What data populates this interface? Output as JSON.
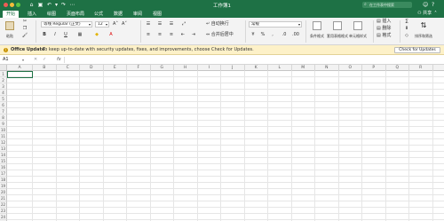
{
  "window": {
    "title": "工作簿1",
    "search_placeholder": "在工作表中搜索"
  },
  "tabs": [
    "开始",
    "插入",
    "绘图",
    "页面布局",
    "公式",
    "数据",
    "审阅",
    "视图"
  ],
  "share_label": "共享",
  "ribbon": {
    "paste_label": "粘贴",
    "font_name": "等线 Regular (正文)",
    "font_size": "12",
    "wrap_label": "自动换行",
    "merge_label": "合并后居中",
    "number_format": "常规",
    "cond_format_label": "条件格式",
    "table_format_label": "套用表格格式",
    "cell_style_label": "单元格样式",
    "insert_label": "插入",
    "delete_label": "删除",
    "format_label": "格式",
    "sort_filter_label": "排序和筛选",
    "bold": "B",
    "italic": "I",
    "underline": "U",
    "currency": "%",
    "sum": "Σ"
  },
  "update_bar": {
    "title": "Office Update",
    "message": "To keep up-to-date with security updates, fixes, and improvements, choose Check for Updates.",
    "button": "Check for Updates"
  },
  "formula_bar": {
    "name_box": "A1",
    "fx": "fx",
    "value": ""
  },
  "grid": {
    "columns": [
      "A",
      "B",
      "C",
      "D",
      "E",
      "F",
      "G",
      "H",
      "I",
      "J",
      "K",
      "L",
      "M",
      "N",
      "O",
      "P",
      "Q",
      "R"
    ],
    "rows": [
      "1",
      "2",
      "3",
      "4",
      "5",
      "6",
      "7",
      "8",
      "9",
      "10",
      "11",
      "12",
      "13",
      "14",
      "15",
      "16",
      "17",
      "18",
      "19",
      "20",
      "21",
      "22",
      "23",
      "24",
      "25"
    ],
    "selected_cell": "A1"
  }
}
